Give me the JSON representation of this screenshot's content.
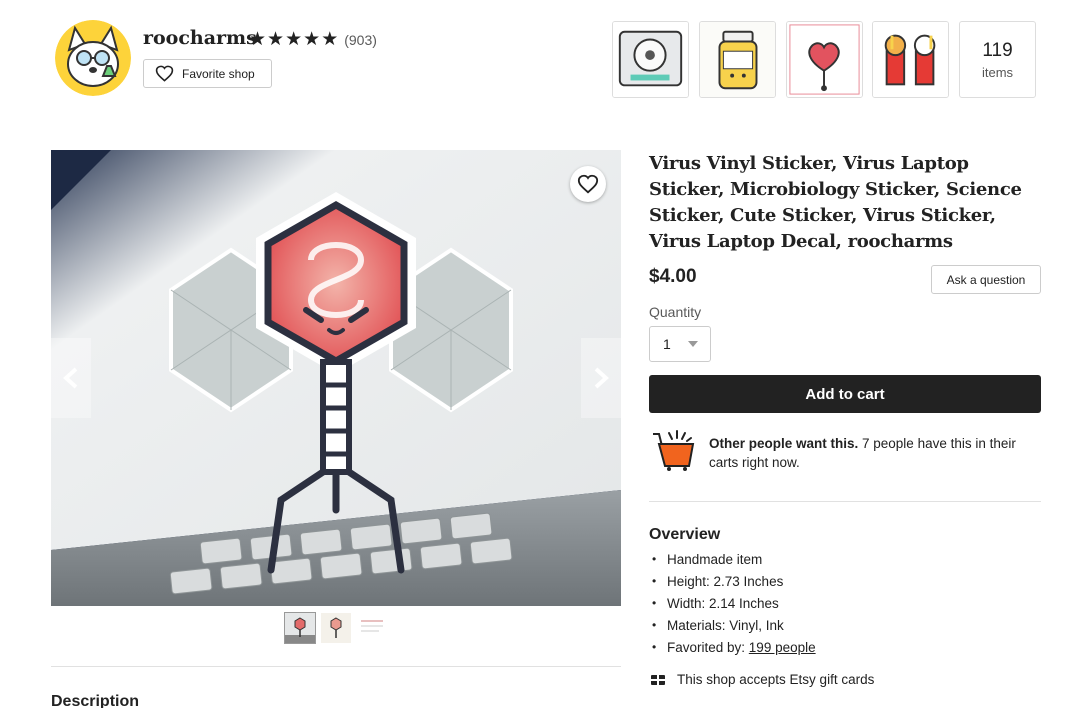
{
  "shop": {
    "name": "roocharms",
    "rating_count": "(903)",
    "stars": [
      "★",
      "★",
      "★",
      "★",
      "★"
    ],
    "favorite_label": "Favorite shop",
    "items_count": "119",
    "items_label": "items",
    "featured_thumbs": [
      "petri-dish-sticker",
      "pill-bottle-sticker",
      "heart-badge-reel",
      "corgi-fries-pin"
    ]
  },
  "gallery": {
    "image_icon": "virus-sticker-photo",
    "thumbnails": [
      "thumb-1",
      "thumb-2",
      "thumb-3"
    ],
    "active_thumb": 0
  },
  "listing": {
    "title": "Virus Vinyl Sticker, Virus Laptop Sticker, Microbiology Sticker, Science Sticker, Cute Sticker, Virus Sticker, Virus Laptop Decal, roocharms",
    "price": "$4.00",
    "ask_label": "Ask a question",
    "quantity_label": "Quantity",
    "quantity_value": "1",
    "add_to_cart": "Add to cart",
    "demand_bold": "Other people want this.",
    "demand_rest": " 7 people have this in their carts right now."
  },
  "overview": {
    "heading": "Overview",
    "items": [
      "Handmade item",
      "Height: 2.73 Inches",
      "Width: 2.14 Inches",
      "Materials: Vinyl, Ink"
    ],
    "favorited_prefix": "Favorited by: ",
    "favorited_link": "199 people",
    "gift_text": "This shop accepts Etsy gift cards"
  },
  "description_heading": "Description",
  "colors": {
    "accent": "#222222",
    "button_bg": "#222222",
    "cart_orange": "#f1641e"
  }
}
